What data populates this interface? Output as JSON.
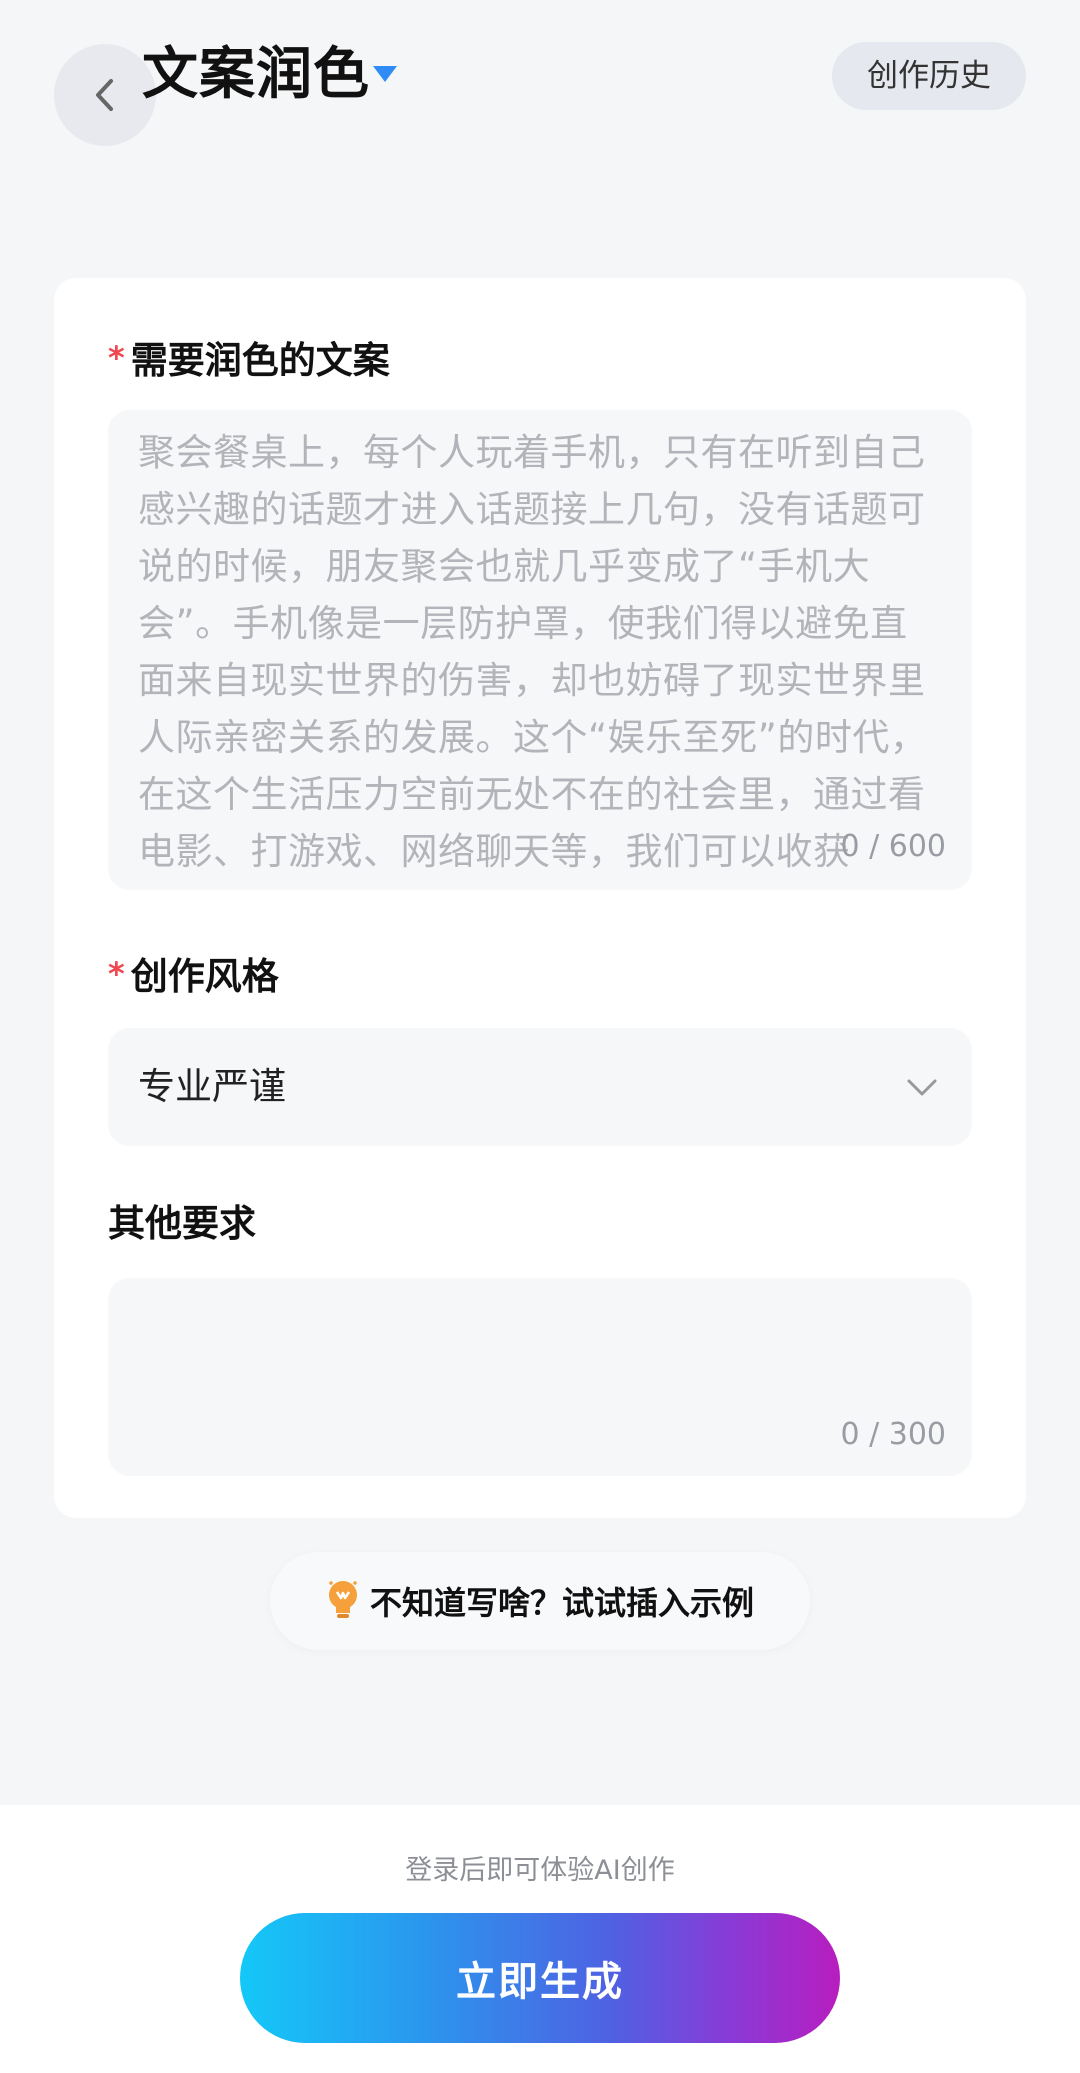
{
  "header": {
    "title": "文案润色",
    "history_label": "创作历史"
  },
  "form": {
    "copy_field": {
      "required_mark": "*",
      "label": "需要润色的文案",
      "placeholder_lines": [
        "聚会餐桌上，每个人玩着手机，只有在听到自己",
        "感兴趣的话题才进入话题接上几句，没有话题可",
        "说的时候，朋友聚会也就几乎变成了“手机大",
        "会”。手机像是一层防护罩，使我们得以避免直",
        "面来自现实世界的伤害，却也妨碍了现实世界里",
        "人际亲密关系的发展。这个“娱乐至死”的时代，",
        "在这个生活压力空前无处不在的社会里，通过看",
        "电影、打游戏、网络聊天等，我们可以收获"
      ],
      "counter": "0 / 600"
    },
    "style_field": {
      "required_mark": "*",
      "label": "创作风格",
      "selected": "专业严谨"
    },
    "other_field": {
      "label": "其他要求",
      "counter": "0 / 300"
    }
  },
  "example": {
    "label": "不知道写啥？试试插入示例"
  },
  "footer": {
    "login_tip": "登录后即可体验AI创作",
    "generate_label": "立即生成"
  },
  "colors": {
    "required": "#f0474f",
    "caret": "#2f8cf5",
    "button_gradient_start": "#14c8f8",
    "button_gradient_end": "#b81dbf"
  },
  "icons": {
    "back": "chevron-left-icon",
    "title_dropdown": "caret-down-icon",
    "select": "chevron-down-icon",
    "example": "lightbulb-icon"
  }
}
